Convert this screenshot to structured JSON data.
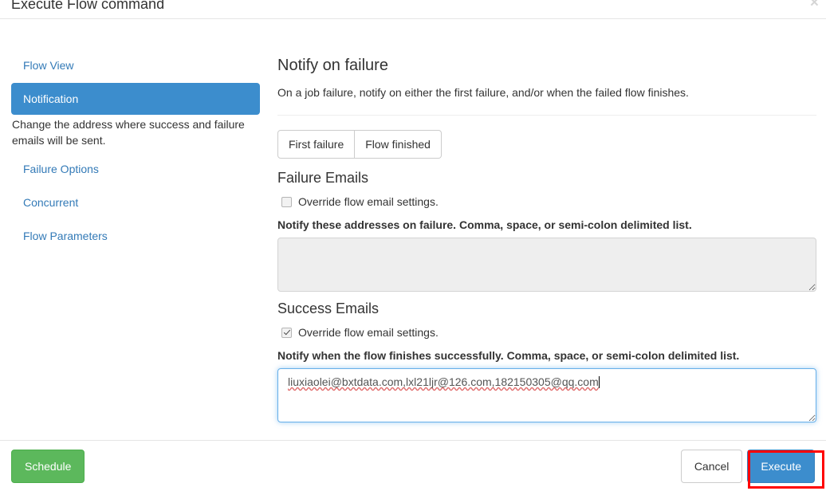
{
  "modal": {
    "title": "Execute Flow command",
    "close_icon": "close-icon",
    "close_glyph": "×"
  },
  "sidebar": {
    "items": [
      {
        "label": "Flow View",
        "active": false
      },
      {
        "label": "Notification",
        "active": true
      },
      {
        "label": "Failure Options",
        "active": false
      },
      {
        "label": "Concurrent",
        "active": false
      },
      {
        "label": "Flow Parameters",
        "active": false
      }
    ],
    "description": "Change the address where success and failure emails will be sent."
  },
  "content": {
    "title": "Notify on failure",
    "subtitle": "On a job failure, notify on either the first failure, and/or when the failed flow finishes.",
    "toggle_group": {
      "options": [
        {
          "label": "First failure",
          "selected": false
        },
        {
          "label": "Flow finished",
          "selected": false
        }
      ]
    },
    "failure_emails": {
      "section_title": "Failure Emails",
      "override_label": "Override flow email settings.",
      "override_checked": false,
      "help_text": "Notify these addresses on failure. Comma, space, or semi-colon delimited list.",
      "value": "",
      "placeholder": "",
      "disabled": true
    },
    "success_emails": {
      "section_title": "Success Emails",
      "override_label": "Override flow email settings.",
      "override_checked": true,
      "help_text": "Notify when the flow finishes successfully. Comma, space, or semi-colon delimited list.",
      "value": "liuxiaolei@bxtdata.com,lxl21ljr@126.com,182150305@qq.com",
      "placeholder": "",
      "disabled": false,
      "focused": true
    }
  },
  "footer": {
    "schedule_label": "Schedule",
    "cancel_label": "Cancel",
    "execute_label": "Execute"
  },
  "colors": {
    "accent_blue": "#3c8dcd",
    "link_blue": "#337ab7",
    "schedule_green": "#5cb85c",
    "highlight_red": "#ff0000",
    "focus_blue": "#66afe9"
  }
}
